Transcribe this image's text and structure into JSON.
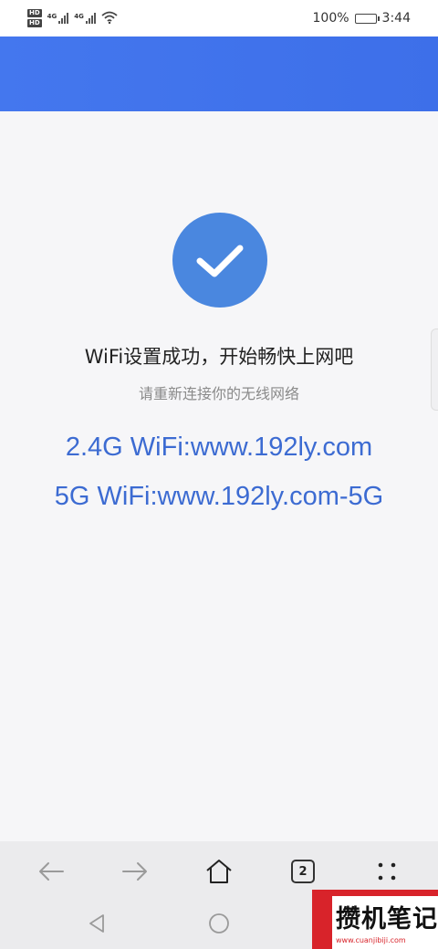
{
  "status_bar": {
    "hd_badges": [
      "HD",
      "HD"
    ],
    "net_labels": [
      "4G",
      "4G"
    ],
    "battery_text": "100%",
    "battery_level_percent": 100,
    "time": "3:44"
  },
  "main": {
    "title": "WiFi设置成功，开始畅快上网吧",
    "subtitle": "请重新连接你的无线网络",
    "wifi_24": "2.4G WiFi:www.192ly.com",
    "wifi_5": "5G WiFi:www.192ly.com-5G"
  },
  "browser_bar": {
    "tab_count": "2"
  },
  "watermark": {
    "text": "攒机笔记",
    "url": "www.cuanjibiji.com"
  },
  "colors": {
    "header": "#4477ee",
    "success_circle": "#4a87df",
    "wifi_text": "#3c6bd2"
  }
}
